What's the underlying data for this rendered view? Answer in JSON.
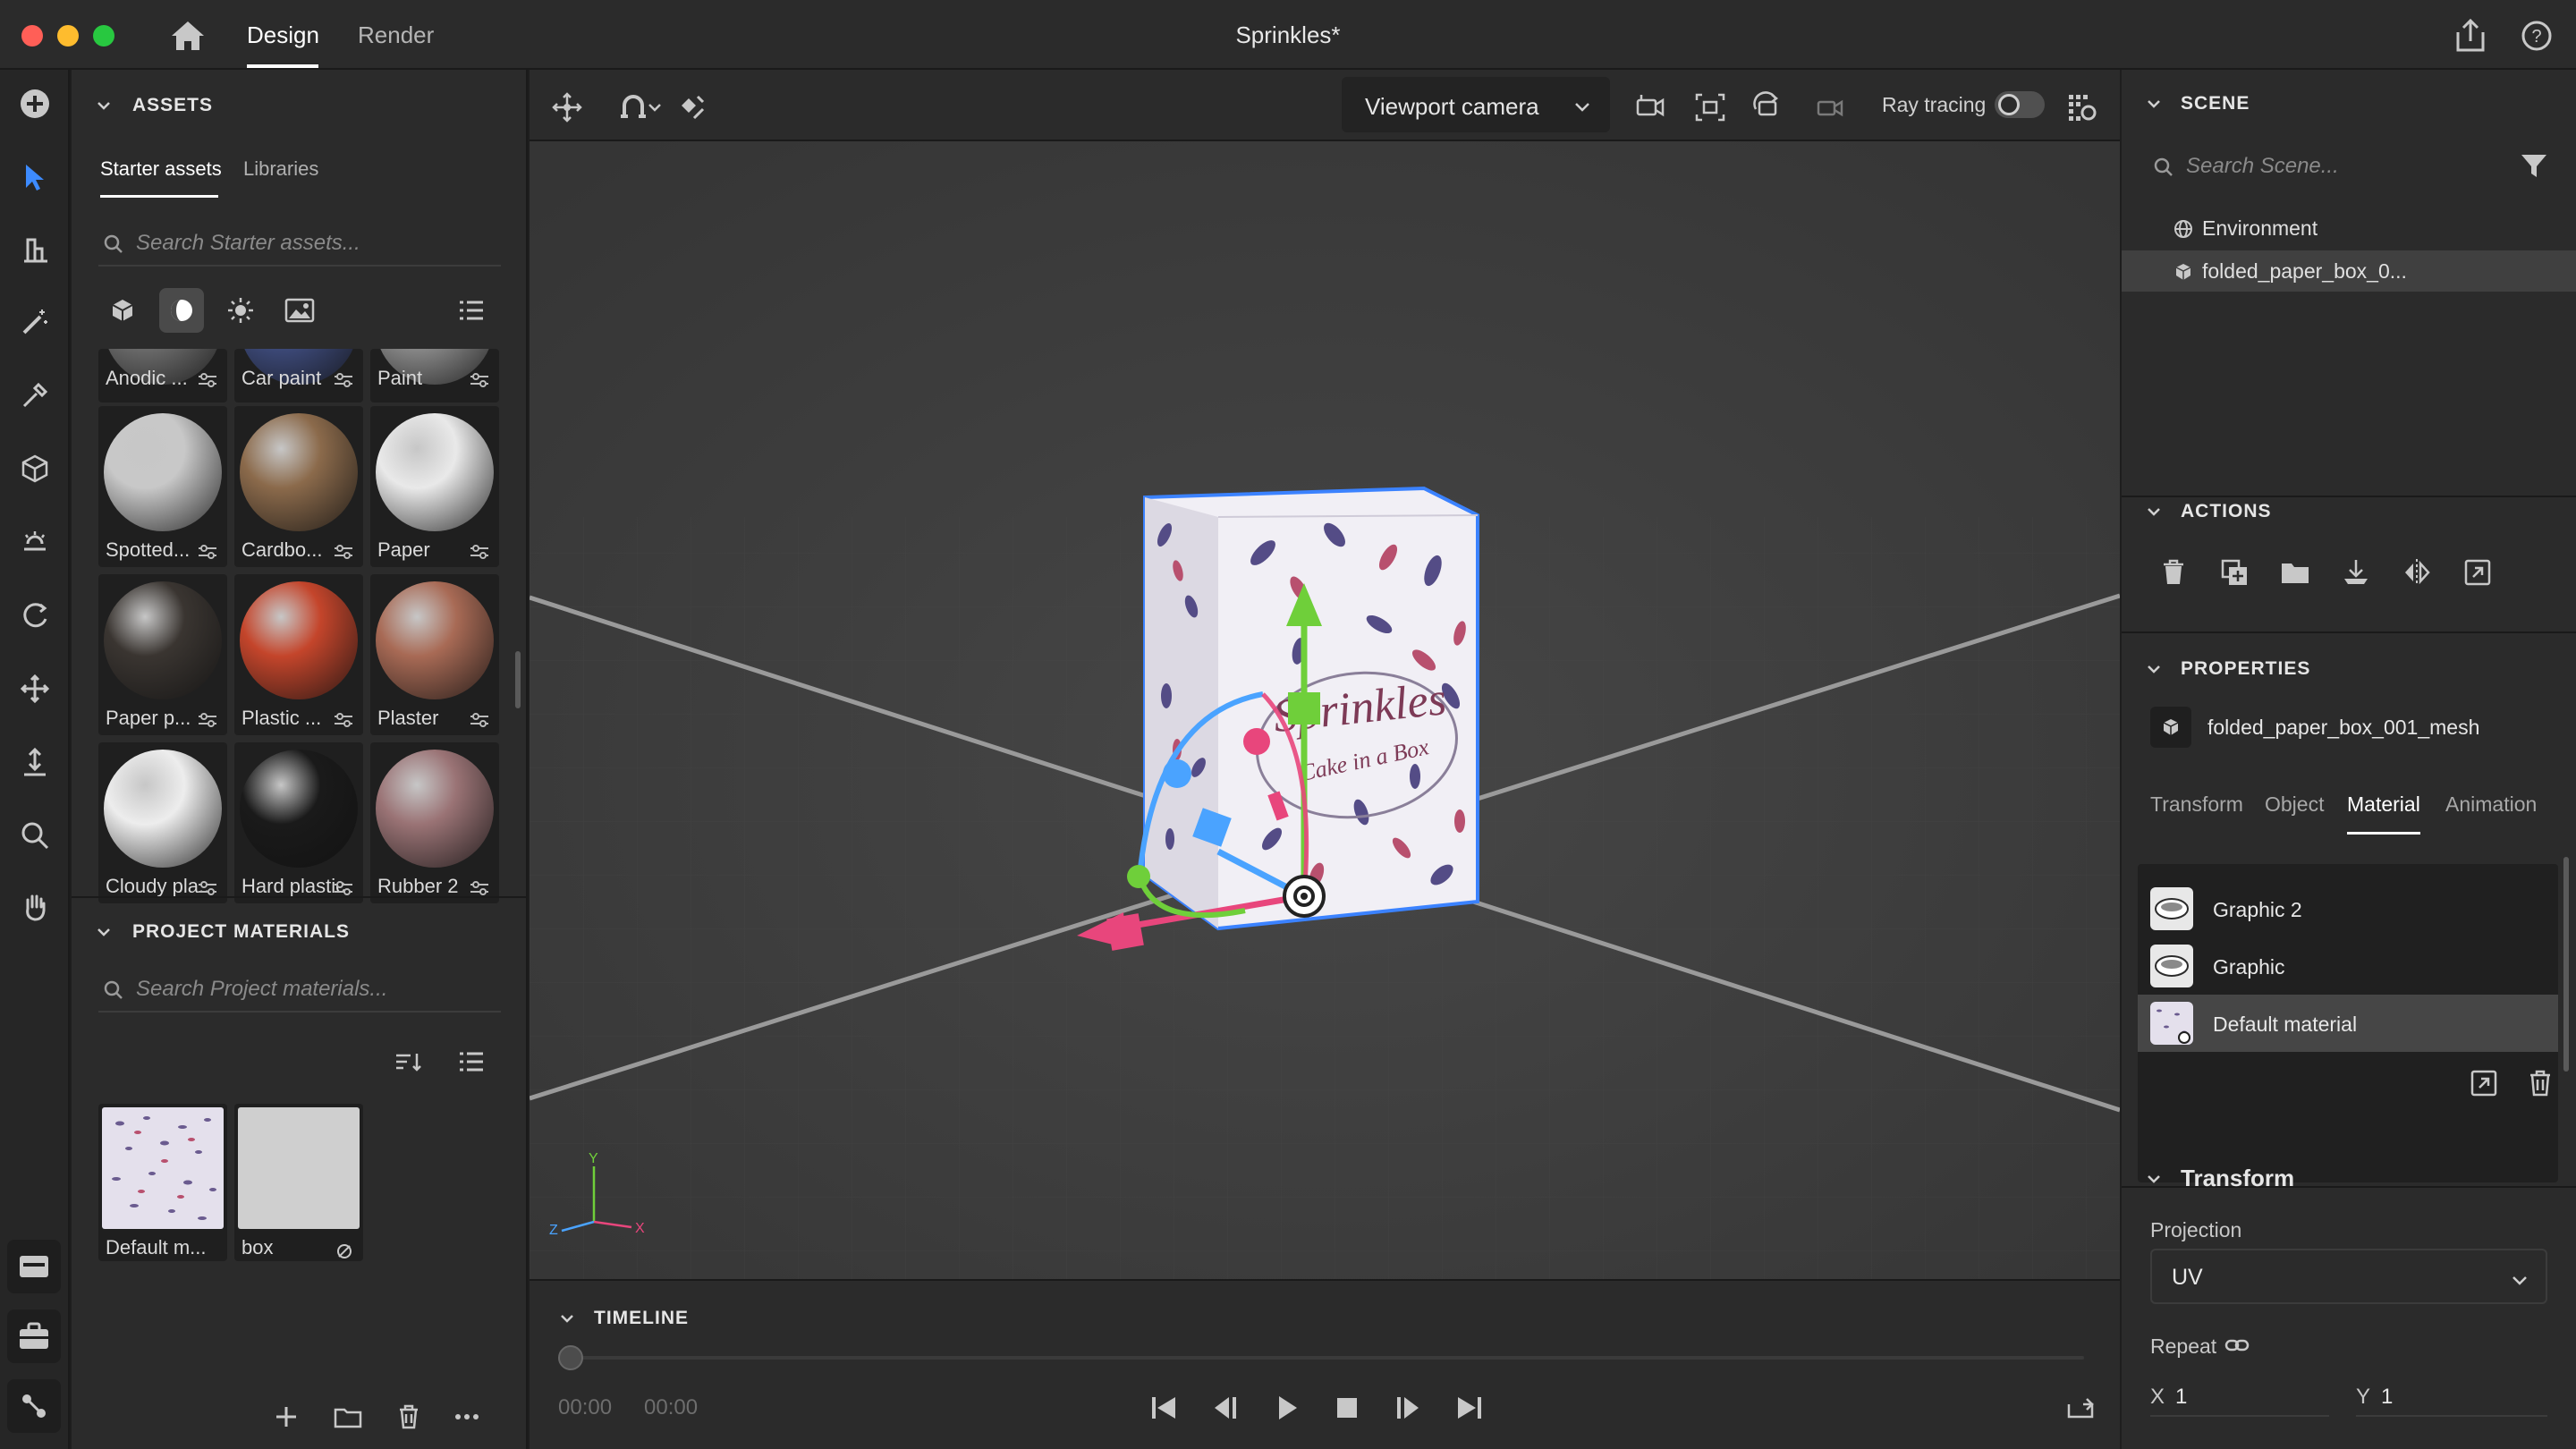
{
  "titlebar": {
    "tabs": [
      "Design",
      "Render"
    ],
    "active_tab": "Design",
    "document_title": "Sprinkles*"
  },
  "assets": {
    "section_title": "ASSETS",
    "subtabs": [
      "Starter assets",
      "Libraries"
    ],
    "active_subtab": "Starter assets",
    "search_placeholder": "Search Starter assets...",
    "filter_icons": [
      "cube-icon",
      "material-sphere-icon",
      "light-icon",
      "image-icon"
    ],
    "partial_row": [
      {
        "label": "Anodic ...",
        "color": "#6c6c6c"
      },
      {
        "label": "Car paint",
        "color": "#3d4a7a"
      },
      {
        "label": "Paint",
        "color": "#8a8a8a"
      }
    ],
    "materials": [
      {
        "label": "Spotted...",
        "color": "#c8c8c8"
      },
      {
        "label": "Cardbo...",
        "color": "#8b6a4b"
      },
      {
        "label": "Paper",
        "color": "#e9e9e9"
      },
      {
        "label": "Paper p...",
        "color": "#3a3531"
      },
      {
        "label": "Plastic ...",
        "color": "#c4452b"
      },
      {
        "label": "Plaster",
        "color": "#a86a55"
      },
      {
        "label": "Cloudy pla...",
        "color": "#ededed"
      },
      {
        "label": "Hard plastic",
        "color": "#1a1a1a"
      },
      {
        "label": "Rubber 2",
        "color": "#9a7375"
      }
    ]
  },
  "project_materials": {
    "section_title": "PROJECT MATERIALS",
    "search_placeholder": "Search Project materials...",
    "items": [
      {
        "label": "Default m..."
      },
      {
        "label": "box"
      }
    ]
  },
  "viewport": {
    "camera": "Viewport camera",
    "ray_tracing_label": "Ray tracing",
    "ray_tracing_on": false,
    "box_text": [
      "Sprinkles",
      "Cake in a Box"
    ],
    "axis_labels": {
      "x": "X",
      "y": "Y",
      "z": "Z"
    }
  },
  "timeline": {
    "section_title": "TIMELINE",
    "current_time": "00:00",
    "end_time": "00:00"
  },
  "scene": {
    "section_title": "SCENE",
    "search_placeholder": "Search Scene...",
    "items": [
      {
        "label": "Environment",
        "icon": "globe-icon"
      },
      {
        "label": "folded_paper_box_0...",
        "icon": "cube-icon",
        "selected": true
      }
    ]
  },
  "actions": {
    "section_title": "ACTIONS",
    "buttons": [
      "delete-icon",
      "duplicate-icon",
      "folder-icon",
      "drop-to-ground-icon",
      "mirror-icon",
      "export-icon"
    ]
  },
  "properties": {
    "section_title": "PROPERTIES",
    "object_name": "folded_paper_box_001_mesh",
    "tabs": [
      "Transform",
      "Object",
      "Material",
      "Animation"
    ],
    "active_tab": "Material",
    "materials": [
      {
        "label": "Graphic 2"
      },
      {
        "label": "Graphic"
      },
      {
        "label": "Default material",
        "selected": true
      }
    ],
    "transform": {
      "title": "Transform",
      "projection_label": "Projection",
      "projection_value": "UV",
      "repeat_label": "Repeat",
      "x_label": "X",
      "x_value": "1",
      "y_label": "Y",
      "y_value": "1"
    }
  },
  "colors": {
    "accent_green": "#6fcf3a",
    "accent_red": "#e8467c",
    "accent_blue": "#4aa3ff",
    "selection_outline": "#3b82ff"
  }
}
